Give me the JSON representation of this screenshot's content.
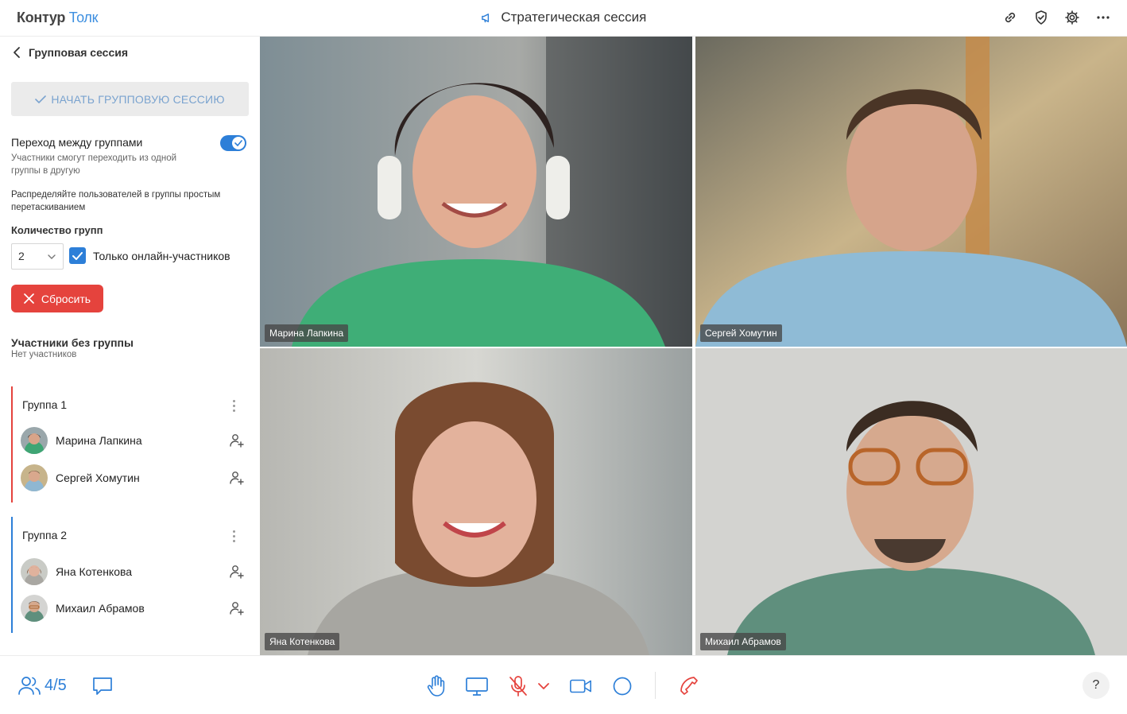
{
  "header": {
    "logo_part1": "Контур",
    "logo_part2": "Толк",
    "title": "Стратегическая сессия",
    "icons": [
      "link-icon",
      "shield-check-icon",
      "gear-icon",
      "more-horizontal-icon"
    ]
  },
  "sidebar": {
    "back_label": "Групповая сессия",
    "start_button": "НАЧАТЬ ГРУППОВУЮ СЕССИЮ",
    "switch_title": "Переход между группами",
    "switch_on": true,
    "switch_desc": "Участники смогут переходить из одной группы в другую",
    "hint": "Распределяйте пользователей в группы простым перетаскиванием",
    "group_count_label": "Количество групп",
    "group_count_value": "2",
    "online_only_label": "Только онлайн-участников",
    "online_only_checked": true,
    "reset_button": "Сбросить",
    "ungrouped_title": "Участники без группы",
    "ungrouped_empty": "Нет участников",
    "groups": [
      {
        "title": "Группа 1",
        "color": "#e5433d",
        "members": [
          "Марина Лапкина",
          "Сергей Хомутин"
        ]
      },
      {
        "title": "Группа 2",
        "color": "#2d7fd8",
        "members": [
          "Яна Котенкова",
          "Михаил Абрамов"
        ]
      }
    ]
  },
  "videos": [
    {
      "name": "Марина Лапкина",
      "active": true
    },
    {
      "name": "Сергей Хомутин",
      "active": false
    },
    {
      "name": "Яна Котенкова",
      "active": true
    },
    {
      "name": "Михаил Абрамов",
      "active": false
    }
  ],
  "bottom_bar": {
    "participants_count": "4/5",
    "icons": [
      "participants-icon",
      "chat-icon",
      "raise-hand-icon",
      "screen-share-icon",
      "microphone-muted-icon",
      "chevron-down-icon",
      "camera-icon",
      "record-icon",
      "hang-up-icon"
    ],
    "help_label": "?"
  },
  "colors": {
    "accent": "#2d7fd8",
    "danger": "#e5433d"
  }
}
